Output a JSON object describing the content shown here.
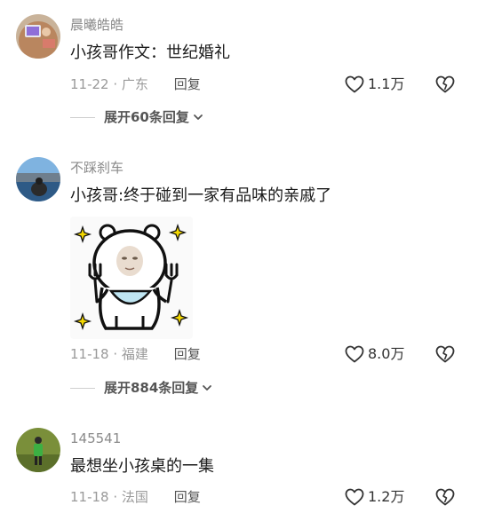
{
  "comments": [
    {
      "username": "晨曦皓皓",
      "content": "小孩哥作文：世纪婚礼",
      "date": "11-22",
      "location": "广东",
      "reply_label": "回复",
      "likes": "1.1万",
      "expand_label": "展开60条回复"
    },
    {
      "username": "不踩刹车",
      "content": "小孩哥:终于碰到一家有品味的亲戚了",
      "date": "11-18",
      "location": "福建",
      "reply_label": "回复",
      "likes": "8.0万",
      "expand_label": "展开884条回复"
    },
    {
      "username": "145541",
      "content": "最想坐小孩桌的一集",
      "date": "11-18",
      "location": "法国",
      "reply_label": "回复",
      "likes": "1.2万"
    }
  ],
  "icons": {
    "like": "heart-outline-icon",
    "dislike": "broken-heart-icon",
    "expand": "chevron-down-icon"
  },
  "colors": {
    "username": "#8a8a8a",
    "meta": "#9a9a9a",
    "text": "#1a1a1a"
  }
}
